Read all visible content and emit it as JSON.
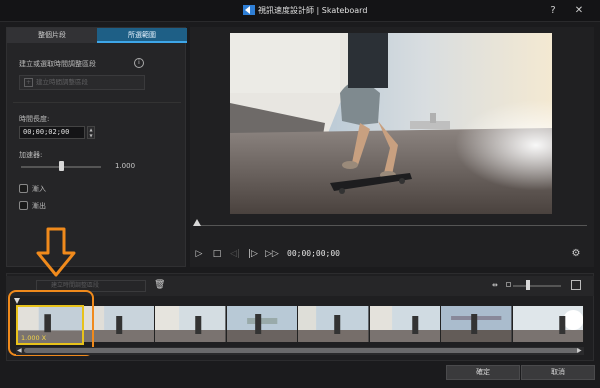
{
  "window": {
    "title": "視訊速度設計師 | Skateboard",
    "help_label": "?",
    "close_label": "✕"
  },
  "left_panel": {
    "tabs": [
      {
        "label": "整個片段"
      },
      {
        "label": "所選範圍"
      }
    ],
    "section_label": "建立或選取時間調整區段",
    "create_button_label": "建立時間調整區段",
    "duration_label": "時間長度:",
    "duration_value": "00;00;02;00",
    "speed_label": "加速器:",
    "speed_value": "1.000",
    "speed_level": 0.5,
    "ease_in_label": "漸入",
    "ease_out_label": "漸出"
  },
  "player": {
    "timecode": "00;00;00;00",
    "scrub_position": 0
  },
  "timeline": {
    "create_button_label": "建立時間調整區段",
    "clip_speed": "1.000 X",
    "zoom_level": 0.3
  },
  "footer": {
    "ok_label": "確定",
    "cancel_label": "取消"
  },
  "colors": {
    "accent_tab": "#1e5f86",
    "clip_border": "#e8c21a",
    "highlight_annotation": "#f08a1c"
  }
}
